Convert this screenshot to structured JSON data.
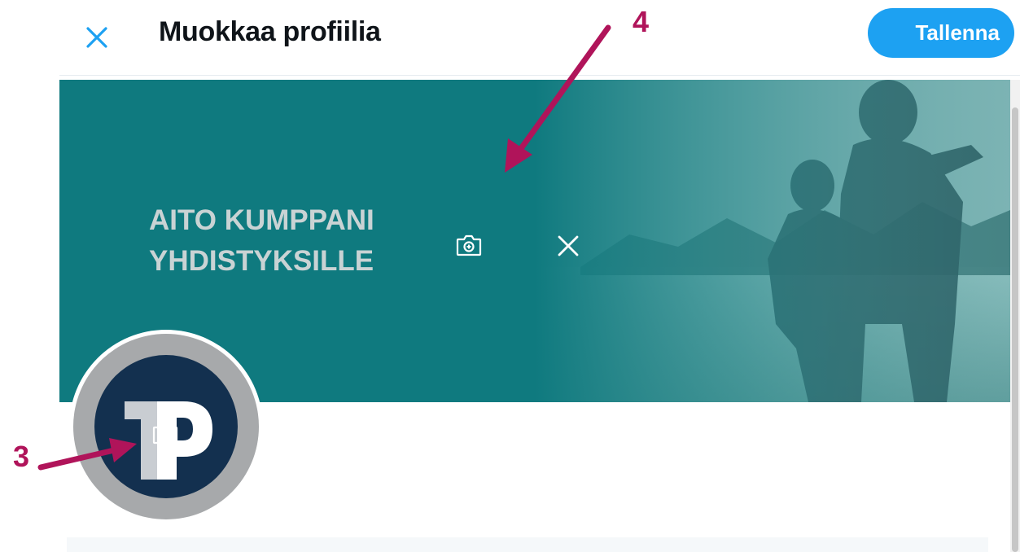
{
  "header": {
    "close_icon": "close-icon",
    "title": "Muokkaa profiilia",
    "save_label": "Tallenna"
  },
  "banner": {
    "text_line1": "AITO KUMPPANI",
    "text_line2": "YHDISTYKSILLE",
    "camera_icon": "add-photo-camera-icon",
    "remove_icon": "close-icon"
  },
  "avatar": {
    "logo_text": "TP",
    "camera_icon": "add-photo-camera-icon"
  },
  "annotations": [
    {
      "label": "3"
    },
    {
      "label": "4"
    }
  ],
  "colors": {
    "accent": "#1da1f2",
    "banner": "#0f7a7f",
    "annotation": "#b0145a",
    "logo_navy": "#13304f",
    "avatar_ring": "#a7a9ab"
  }
}
